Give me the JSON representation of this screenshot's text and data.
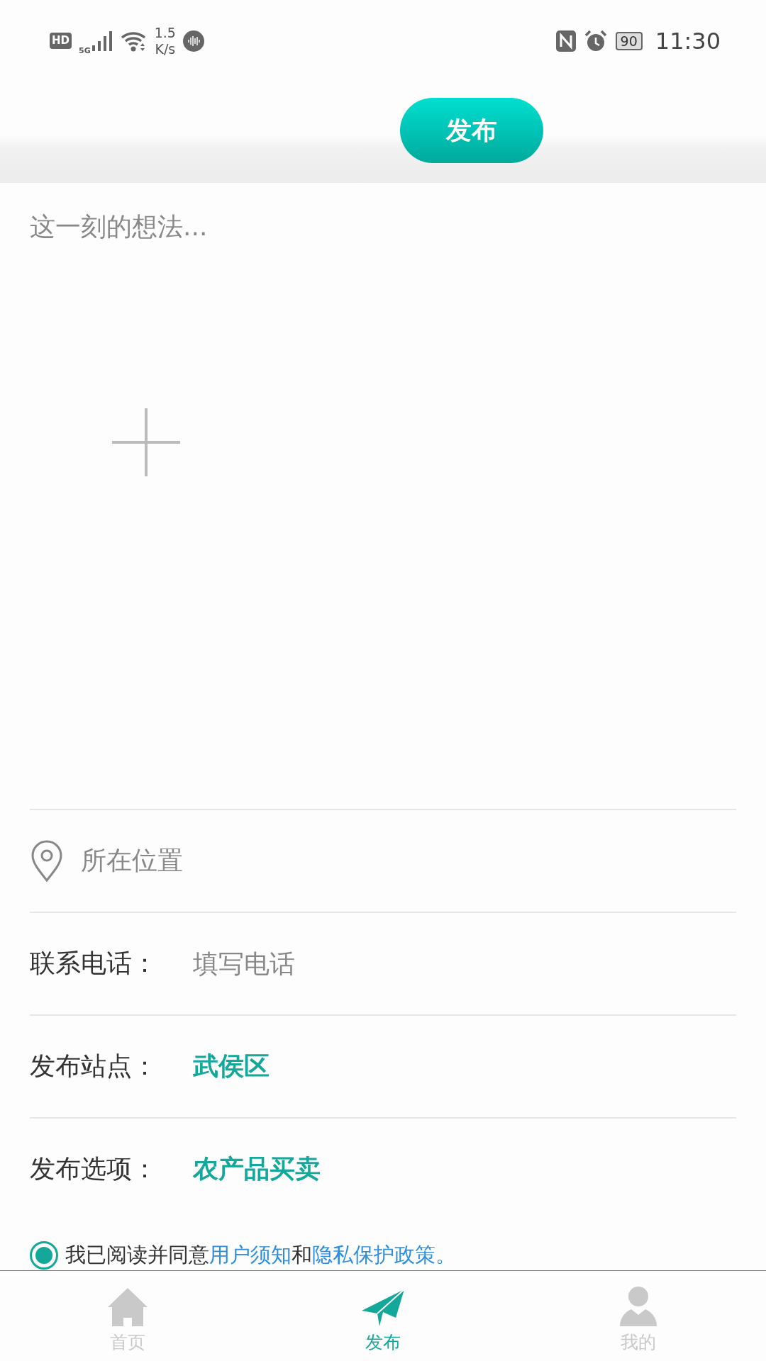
{
  "status_bar": {
    "hd": "HD",
    "network": "5G",
    "speed_value": "1.5",
    "speed_unit": "K/s",
    "battery": "90",
    "time": "11:30"
  },
  "header": {
    "publish_button": "发布"
  },
  "post": {
    "placeholder": "这一刻的想法..."
  },
  "rows": [
    {
      "kind": "location",
      "placeholder": "所在位置"
    },
    {
      "kind": "input",
      "label": "联系电话：",
      "placeholder": "填写电话"
    },
    {
      "kind": "select",
      "label": "发布站点：",
      "value": "武侯区"
    },
    {
      "kind": "select",
      "label": "发布选项：",
      "value": "农产品买卖"
    }
  ],
  "agreement": {
    "checked": true,
    "text": "我已阅读并同意",
    "link_1": "用户须知",
    "joiner": "和",
    "link_2": "隐私保护政策。"
  },
  "nav": [
    {
      "kind": "home",
      "label": "首页",
      "selected": false
    },
    {
      "kind": "publish",
      "label": "发布",
      "selected": true
    },
    {
      "kind": "profile",
      "label": "我的",
      "selected": false
    }
  ]
}
